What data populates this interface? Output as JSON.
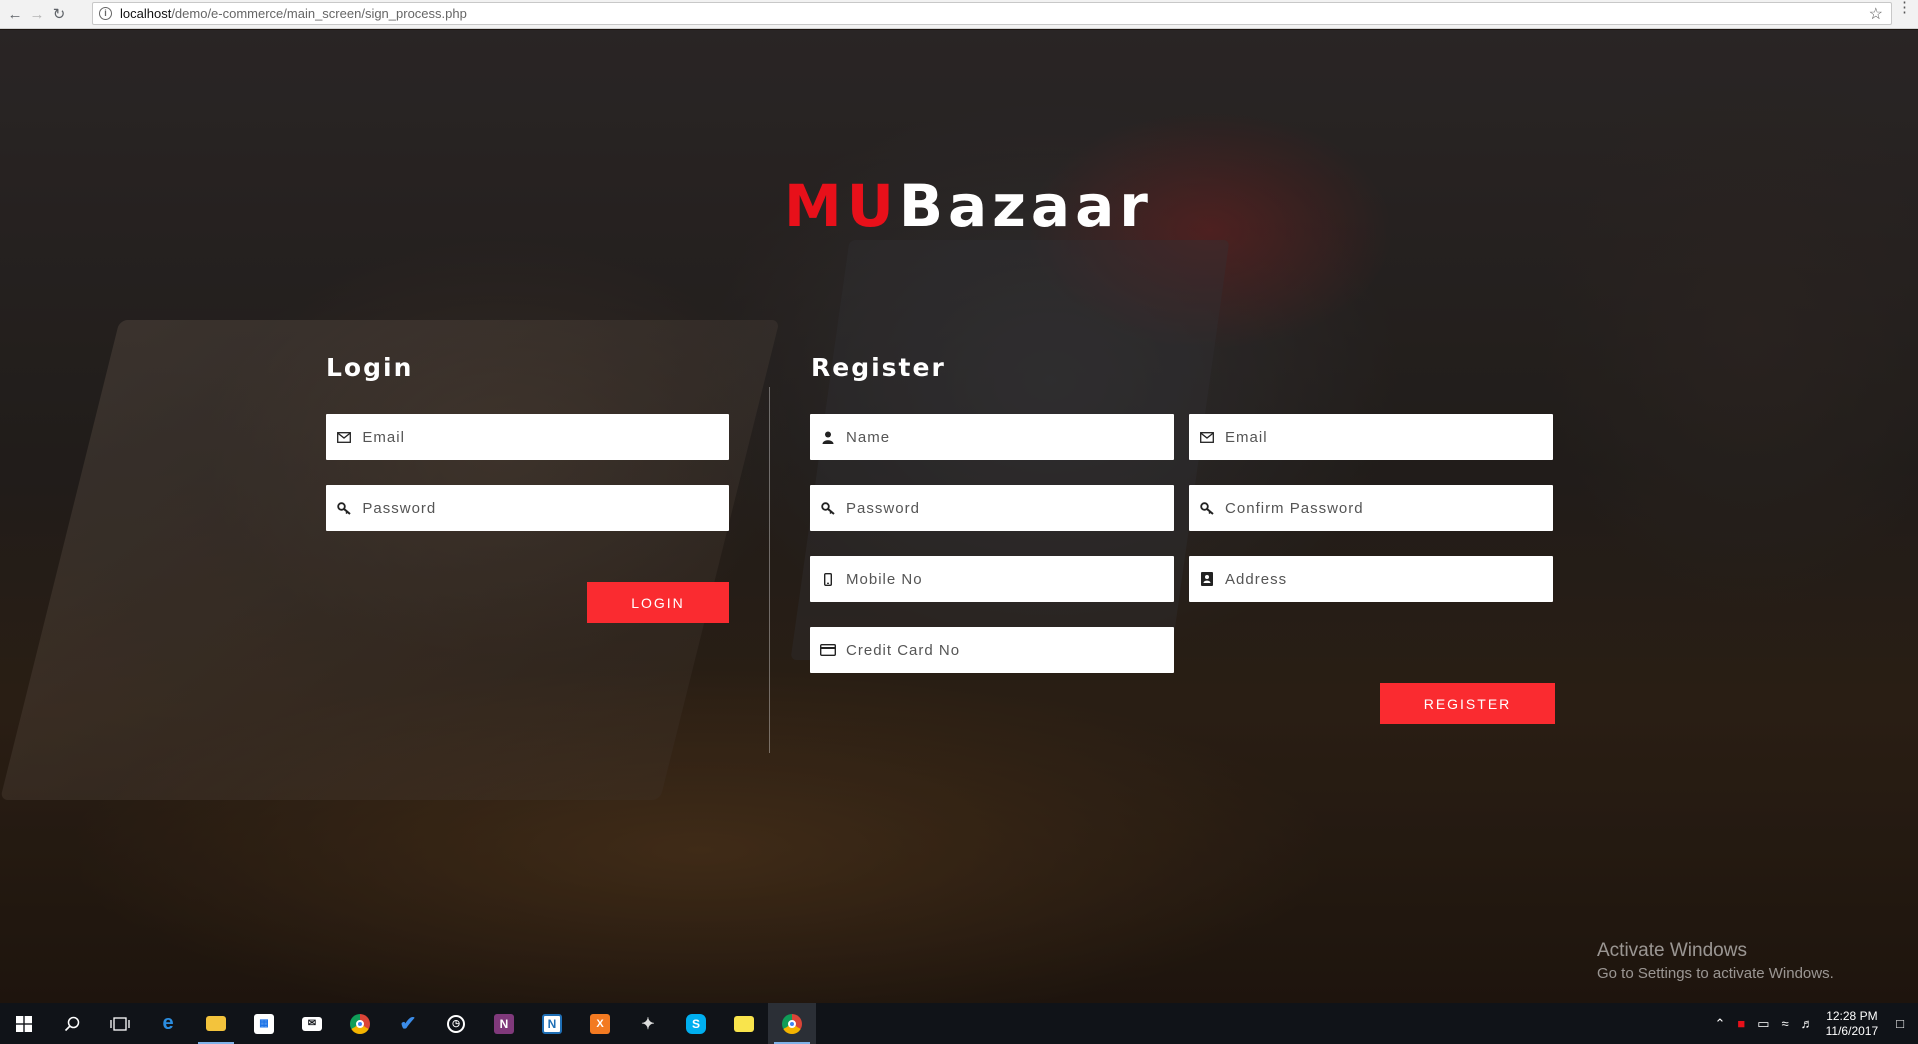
{
  "browser": {
    "url_host": "localhost",
    "url_path": "/demo/e-commerce/main_screen/sign_process.php"
  },
  "brand": {
    "part1": "MU",
    "part2": "Bazaar"
  },
  "login": {
    "title": "Login",
    "email_placeholder": "Email",
    "password_placeholder": "Password",
    "button": "LOGIN"
  },
  "register": {
    "title": "Register",
    "name_placeholder": "Name",
    "email_placeholder": "Email",
    "password_placeholder": "Password",
    "confirm_password_placeholder": "Confirm Password",
    "mobile_placeholder": "Mobile No",
    "address_placeholder": "Address",
    "credit_card_placeholder": "Credit Card No",
    "button": "REGISTER"
  },
  "watermark": {
    "line1": "Activate Windows",
    "line2": "Go to Settings to activate Windows."
  },
  "taskbar": {
    "time": "12:28 PM",
    "date": "11/6/2017"
  },
  "colors": {
    "accent": "#fa2b30",
    "brand_red": "#e8101a"
  }
}
